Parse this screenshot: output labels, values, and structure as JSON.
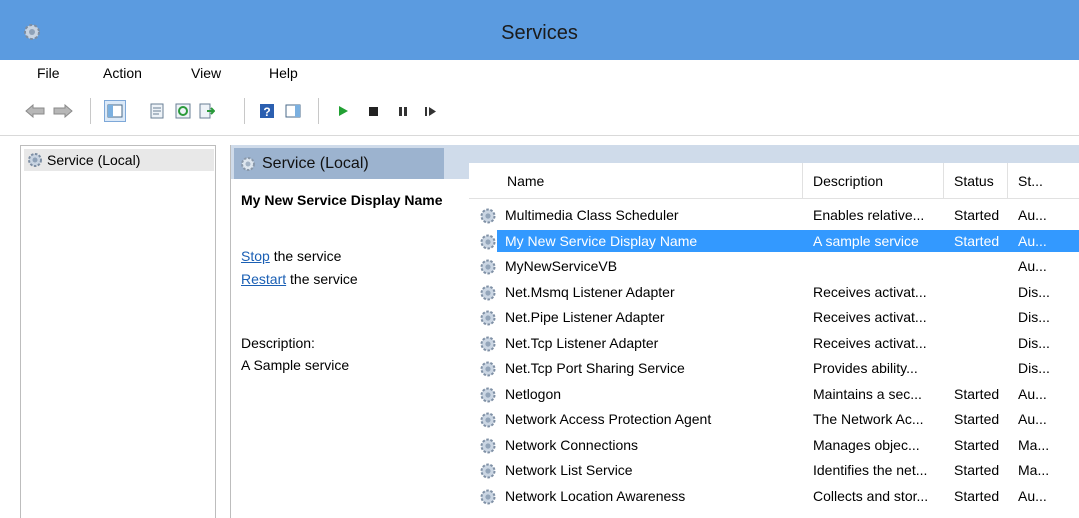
{
  "window": {
    "title": "Services",
    "app_icon": "gear-icon"
  },
  "menu": [
    "File",
    "Action",
    "View",
    "Help"
  ],
  "toolbar": {
    "buttons": [
      {
        "name": "back-arrow-icon"
      },
      {
        "name": "forward-arrow-icon"
      },
      {
        "name": "show-hide-console-tree-icon"
      },
      {
        "name": "properties-icon"
      },
      {
        "name": "refresh-icon"
      },
      {
        "name": "export-list-icon"
      },
      {
        "name": "help-icon"
      },
      {
        "name": "show-action-pane-icon"
      },
      {
        "name": "start-service-icon"
      },
      {
        "name": "stop-service-icon"
      },
      {
        "name": "pause-service-icon"
      },
      {
        "name": "resume-service-icon"
      }
    ]
  },
  "tree": {
    "item_label": "Service (Local)"
  },
  "right_header": {
    "label": "Service (Local)"
  },
  "detail": {
    "service_name": "My New Service Display Name",
    "stop_link": "Stop",
    "stop_suffix": " the service",
    "restart_link": "Restart",
    "restart_suffix": " the service",
    "description_label": "Description:",
    "description_text": "A Sample service"
  },
  "columns": [
    "Name",
    "Description",
    "Status",
    "St..."
  ],
  "rows": [
    {
      "name": "Multimedia Class Scheduler",
      "description": "Enables relative...",
      "status": "Started",
      "startup": "Au..."
    },
    {
      "name": "My New Service Display Name",
      "description": "A sample service",
      "status": "Started",
      "startup": "Au...",
      "selected": true
    },
    {
      "name": "MyNewServiceVB",
      "description": "",
      "status": "",
      "startup": "Au..."
    },
    {
      "name": "Net.Msmq Listener Adapter",
      "description": "Receives activat...",
      "status": "",
      "startup": "Dis..."
    },
    {
      "name": "Net.Pipe Listener Adapter",
      "description": "Receives activat...",
      "status": "",
      "startup": "Dis..."
    },
    {
      "name": "Net.Tcp Listener Adapter",
      "description": "Receives activat...",
      "status": "",
      "startup": "Dis..."
    },
    {
      "name": "Net.Tcp Port Sharing Service",
      "description": "Provides ability...",
      "status": "",
      "startup": "Dis..."
    },
    {
      "name": "Netlogon",
      "description": "Maintains a sec...",
      "status": "Started",
      "startup": "Au..."
    },
    {
      "name": "Network Access Protection Agent",
      "description": "The Network Ac...",
      "status": "Started",
      "startup": "Au..."
    },
    {
      "name": "Network Connections",
      "description": "Manages objec...",
      "status": "Started",
      "startup": "Ma..."
    },
    {
      "name": "Network List Service",
      "description": "Identifies the net...",
      "status": "Started",
      "startup": "Ma..."
    },
    {
      "name": "Network Location Awareness",
      "description": "Collects and stor...",
      "status": "Started",
      "startup": "Au..."
    }
  ],
  "colors": {
    "titlebar": "#5b9be0",
    "selection": "#3399ff",
    "link": "#1a5fb4",
    "play": "#22a033"
  }
}
